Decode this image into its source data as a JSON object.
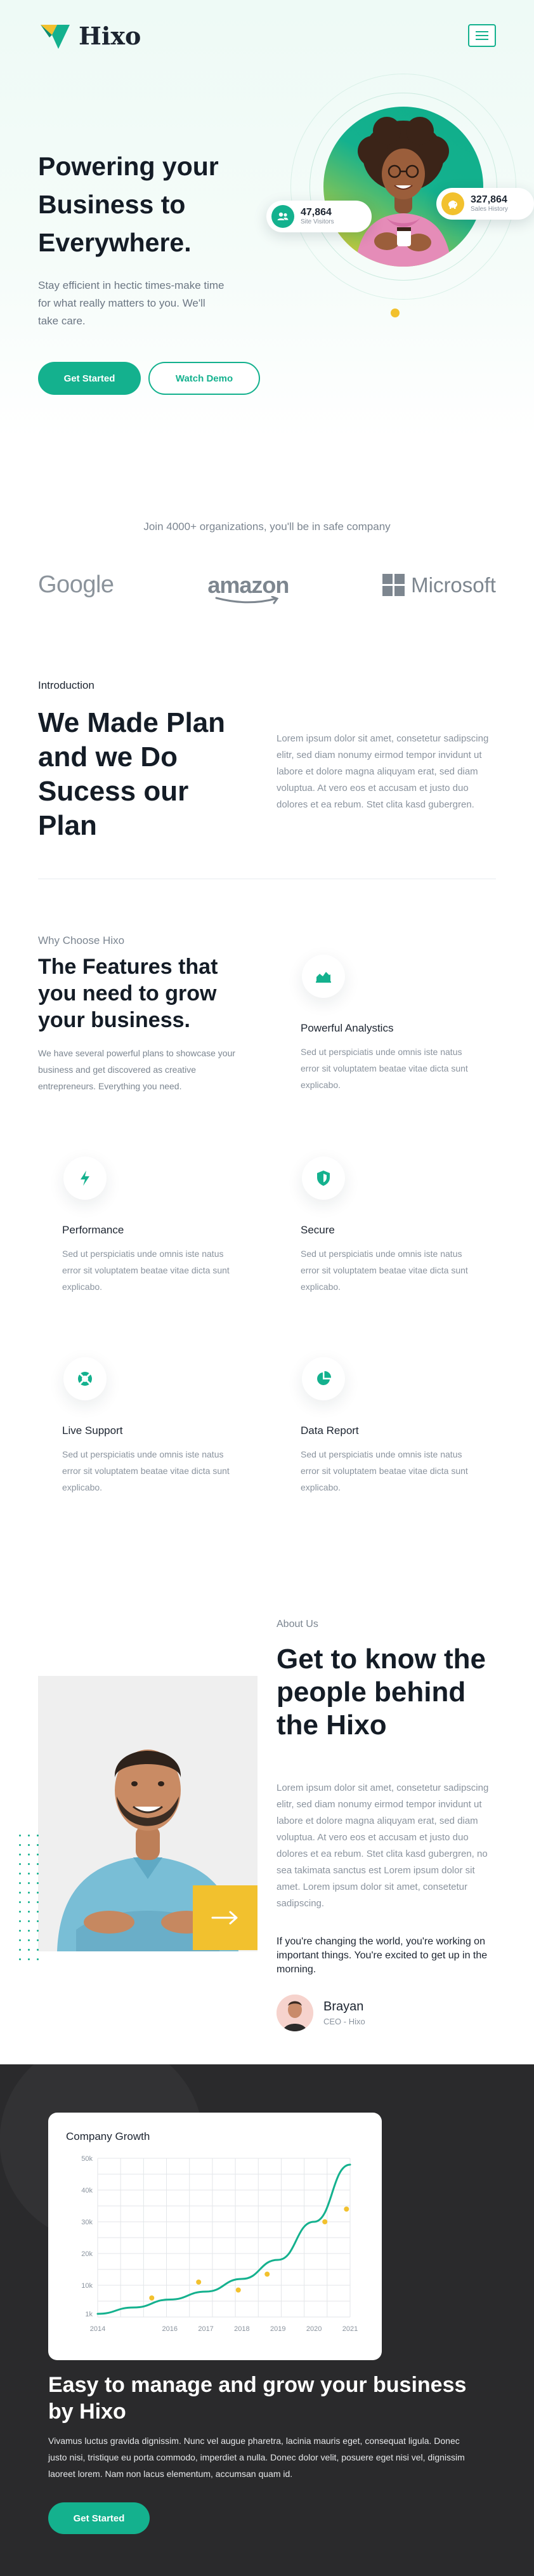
{
  "nav": {
    "brand": "Hixo",
    "menu_icon": "hamburger-menu-icon"
  },
  "colors": {
    "accent": "#14b18e",
    "yellow": "#f2c12e",
    "dark_bg": "#2a2a2c",
    "heading": "#141c26",
    "muted": "#8a939e"
  },
  "hero": {
    "title": "Powering your Business to Everywhere.",
    "subtitle": "Stay efficient in hectic times-make time for what really matters to you. We'll take care.",
    "primary_cta": "Get Started",
    "secondary_cta": "Watch Demo",
    "stats": [
      {
        "value": "47,864",
        "label": "Site Visitors",
        "icon": "users-icon"
      },
      {
        "value": "327,864",
        "label": "Sales History",
        "icon": "piggy-bank-icon"
      }
    ]
  },
  "clients": {
    "tagline": "Join 4000+ organizations, you'll be in safe company",
    "logos": [
      "Google",
      "amazon",
      "Microsoft"
    ]
  },
  "intro": {
    "label": "Introduction",
    "title": "We Made Plan and we Do Sucess our Plan",
    "text": "Lorem ipsum dolor sit amet, consetetur sadipscing elitr, sed diam nonumy eirmod tempor invidunt ut labore et dolore magna aliquyam erat, sed diam voluptua. At vero eos et accusam et justo duo dolores et ea rebum. Stet clita kasd gubergren."
  },
  "features": {
    "label": "Why Choose Hixo",
    "title": "The Features that you need to grow your business.",
    "subtitle": "We have several powerful plans to showcase your business and get discovered as creative entrepreneurs. Everything you need.",
    "items": [
      {
        "name": "Powerful Analystics",
        "desc": "Sed ut perspiciatis unde omnis iste natus error sit voluptatem beatae vitae dicta sunt explicabo.",
        "icon": "bar-chart-icon"
      },
      {
        "name": "Performance",
        "desc": "Sed ut perspiciatis unde omnis iste natus error sit voluptatem beatae vitae dicta sunt explicabo.",
        "icon": "lightning-icon"
      },
      {
        "name": "Secure",
        "desc": "Sed ut perspiciatis unde omnis iste natus error sit voluptatem beatae vitae dicta sunt explicabo.",
        "icon": "shield-icon"
      },
      {
        "name": "Live Support",
        "desc": "Sed ut perspiciatis unde omnis iste natus error sit voluptatem beatae vitae dicta sunt explicabo.",
        "icon": "lifebuoy-icon"
      },
      {
        "name": "Data Report",
        "desc": "Sed ut perspiciatis unde omnis iste natus error sit voluptatem beatae vitae dicta sunt explicabo.",
        "icon": "pie-chart-icon"
      }
    ]
  },
  "about": {
    "label": "About Us",
    "title": "Get to know the people behind the Hixo",
    "text": "Lorem ipsum dolor sit amet, consetetur sadipscing elitr, sed diam nonumy eirmod tempor invidunt ut labore et dolore magna aliquyam erat, sed diam voluptua. At vero eos et accusam et justo duo dolores et ea rebum. Stet clita kasd gubergren, no sea takimata sanctus est Lorem ipsum dolor sit amet. Lorem ipsum dolor sit amet, consetetur sadipscing.",
    "quote": "If you're changing the world, you're working on important things. You're excited to get up in the morning.",
    "author_name": "Brayan",
    "author_role": "CEO - Hixo",
    "arrow_icon": "arrow-right-icon"
  },
  "growth": {
    "title": "Easy to manage and grow your business by Hixo",
    "text": "Vivamus luctus gravida dignissim. Nunc vel augue pharetra, lacinia mauris eget, consequat ligula. Donec justo nisi, tristique eu porta commodo, imperdiet a nulla. Donec dolor velit, posuere eget nisi vel, dignissim laoreet lorem. Nam non lacus elementum, accumsan quam id.",
    "cta": "Get Started"
  },
  "chart_data": {
    "type": "line",
    "title": "Company Growth",
    "x_ticks": [
      "2014",
      "2016",
      "2017",
      "2018",
      "2019",
      "2020",
      "2021"
    ],
    "y_ticks": [
      "1k",
      "10k",
      "20k",
      "30k",
      "40k",
      "50k"
    ],
    "series": [
      {
        "kind": "line",
        "x": [
          2014,
          2015,
          2016,
          2017,
          2018,
          2019,
          2020,
          2021
        ],
        "y": [
          1,
          3,
          5.5,
          8,
          12,
          18,
          30,
          48
        ]
      },
      {
        "kind": "scatter",
        "x": [
          2015.5,
          2016.8,
          2017.9,
          2018.7,
          2020.3,
          2020.9
        ],
        "y": [
          6,
          11,
          8.5,
          13.5,
          30,
          34
        ]
      }
    ],
    "xlim": [
      2014,
      2021
    ],
    "ylim": [
      0,
      50
    ],
    "grid": true
  }
}
